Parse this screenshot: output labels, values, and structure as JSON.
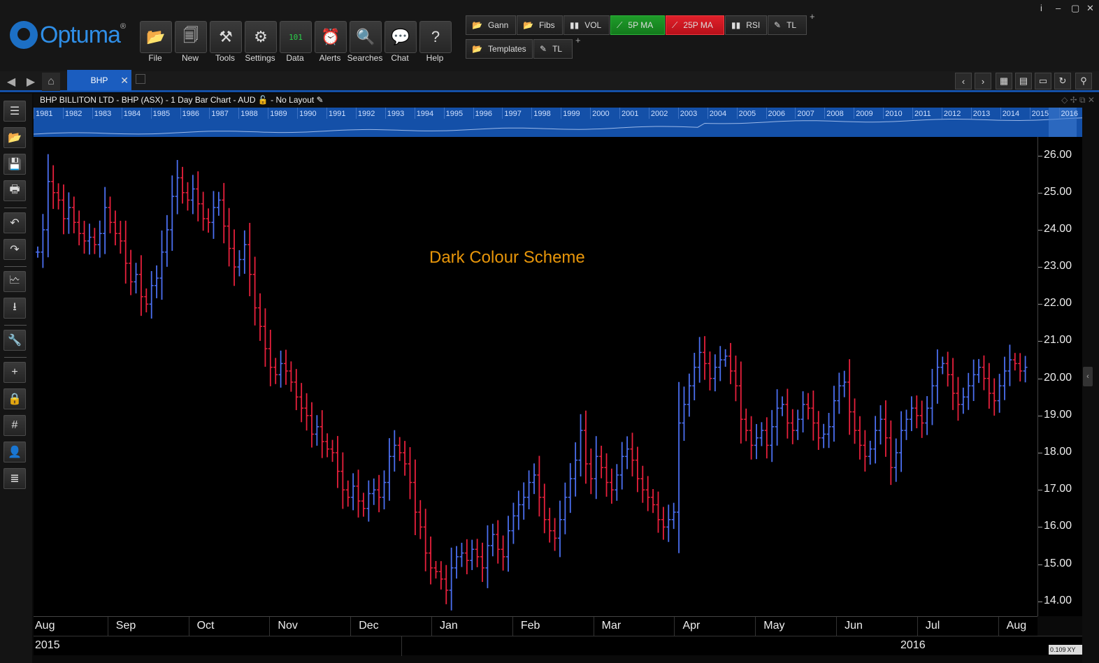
{
  "app": {
    "logo_text": "Optuma",
    "logo_mark": "®"
  },
  "window_controls": [
    "i",
    "–",
    "▢",
    "✕"
  ],
  "toolbar": [
    {
      "label": "File",
      "icon": "folder-icon",
      "glyph": "📂"
    },
    {
      "label": "New",
      "icon": "new-chart-icon",
      "glyph": "🗐"
    },
    {
      "label": "Tools",
      "icon": "tools-icon",
      "glyph": "⚒"
    },
    {
      "label": "Settings",
      "icon": "gears-icon",
      "glyph": "⚙"
    },
    {
      "label": "Data",
      "icon": "binary-data-icon",
      "glyph": "101"
    },
    {
      "label": "Alerts",
      "icon": "alarm-clock-icon",
      "glyph": "⏰"
    },
    {
      "label": "Searches",
      "icon": "magnifier-icon",
      "glyph": "🔍"
    },
    {
      "label": "Chat",
      "icon": "chat-bubbles-icon",
      "glyph": "💬"
    },
    {
      "label": "Help",
      "icon": "question-icon",
      "glyph": "?"
    }
  ],
  "quick_row1": [
    {
      "label": "Gann",
      "icon": "folder-icon",
      "glyph": "📂",
      "style": ""
    },
    {
      "label": "Fibs",
      "icon": "folder-icon",
      "glyph": "📂",
      "style": ""
    },
    {
      "label": "VOL",
      "icon": "bars-icon",
      "glyph": "▮▮",
      "style": ""
    },
    {
      "label": "5P MA",
      "icon": "line-icon",
      "glyph": "⟋",
      "style": "green"
    },
    {
      "label": "25P MA",
      "icon": "line-icon",
      "glyph": "⟋",
      "style": "red"
    },
    {
      "label": "RSI",
      "icon": "bars-icon",
      "glyph": "▮▮",
      "style": ""
    },
    {
      "label": "TL",
      "icon": "pencil-icon",
      "glyph": "✎",
      "style": ""
    }
  ],
  "quick_row2": [
    {
      "label": "Templates",
      "icon": "folder-icon",
      "glyph": "📂",
      "style": ""
    },
    {
      "label": "TL",
      "icon": "pencil-icon",
      "glyph": "✎",
      "style": ""
    }
  ],
  "tab": {
    "label": "BHP",
    "close": "✕"
  },
  "chart": {
    "header": "BHP BILLITON LTD - BHP (ASX) - 1 Day Bar Chart - AUD",
    "layout": "- No Layout",
    "annotation": "Dark Colour Scheme",
    "ratio_label": "0.109",
    "ratio_suffix": "XY"
  },
  "overview_years": [
    "1981",
    "1982",
    "1983",
    "1984",
    "1985",
    "1986",
    "1987",
    "1988",
    "1989",
    "1990",
    "1991",
    "1992",
    "1993",
    "1994",
    "1995",
    "1996",
    "1997",
    "1998",
    "1999",
    "2000",
    "2001",
    "2002",
    "2003",
    "2004",
    "2005",
    "2006",
    "2007",
    "2008",
    "2009",
    "2010",
    "2011",
    "2012",
    "2013",
    "2014",
    "2015",
    "2016"
  ],
  "chart_data": {
    "type": "bar",
    "title": "BHP BILLITON LTD - BHP (ASX) - 1 Day Bar Chart - AUD",
    "ylim": [
      13.6,
      26.5
    ],
    "y_ticks": [
      "26.00",
      "25.00",
      "24.00",
      "23.00",
      "22.00",
      "21.00",
      "20.00",
      "19.00",
      "18.00",
      "17.00",
      "16.00",
      "15.00",
      "14.00"
    ],
    "x_months": [
      "Aug",
      "Sep",
      "Oct",
      "Nov",
      "Dec",
      "Jan",
      "Feb",
      "Mar",
      "Apr",
      "May",
      "Jun",
      "Jul",
      "Aug"
    ],
    "x_years": [
      "2015",
      "2016"
    ],
    "colors": {
      "up": "#4b6ff0",
      "down": "#e8203c",
      "background": "#000000"
    },
    "closes": [
      23.4,
      24.0,
      25.3,
      25.0,
      24.8,
      24.3,
      24.6,
      24.2,
      23.9,
      23.7,
      23.8,
      23.6,
      23.9,
      24.6,
      24.2,
      23.9,
      23.7,
      23.1,
      22.6,
      22.8,
      22.2,
      22.0,
      22.5,
      22.7,
      23.4,
      24.0,
      24.9,
      25.4,
      25.0,
      24.8,
      25.1,
      24.7,
      24.3,
      24.2,
      24.6,
      24.8,
      24.1,
      23.5,
      23.0,
      23.2,
      23.6,
      22.8,
      21.9,
      21.4,
      20.8,
      20.3,
      20.1,
      20.4,
      20.2,
      19.9,
      19.5,
      19.2,
      19.0,
      18.5,
      18.7,
      18.3,
      18.1,
      18.0,
      17.5,
      17.0,
      16.8,
      17.1,
      16.7,
      16.5,
      16.9,
      17.0,
      16.8,
      17.2,
      17.9,
      18.2,
      18.0,
      17.7,
      17.2,
      16.4,
      16.0,
      15.3,
      14.9,
      14.8,
      14.6,
      14.3,
      14.9,
      15.2,
      15.3,
      15.1,
      15.4,
      15.2,
      14.9,
      15.5,
      15.8,
      15.4,
      15.2,
      15.9,
      16.3,
      16.6,
      16.8,
      17.2,
      17.4,
      16.8,
      16.2,
      15.9,
      15.7,
      16.2,
      16.8,
      17.3,
      17.8,
      18.6,
      17.7,
      17.3,
      17.9,
      17.6,
      17.2,
      17.0,
      17.4,
      17.9,
      18.1,
      17.8,
      17.3,
      17.0,
      16.8,
      16.6,
      16.2,
      16.0,
      16.2,
      16.4,
      18.8,
      19.3,
      19.8,
      20.3,
      20.7,
      20.4,
      20.0,
      20.3,
      20.5,
      20.6,
      20.2,
      19.8,
      18.9,
      18.6,
      18.2,
      18.4,
      18.6,
      18.2,
      18.7,
      19.2,
      19.3,
      18.8,
      18.6,
      18.9,
      19.3,
      19.2,
      18.8,
      18.4,
      18.5,
      18.7,
      19.4,
      19.8,
      19.9,
      19.1,
      18.6,
      18.2,
      17.9,
      18.1,
      18.6,
      18.9,
      18.4,
      17.6,
      18.0,
      18.6,
      18.9,
      19.2,
      19.0,
      18.8,
      19.2,
      19.8,
      20.3,
      20.4,
      20.1,
      19.6,
      19.3,
      19.5,
      19.8,
      20.1,
      20.3,
      20.0,
      19.6,
      19.4,
      19.8,
      20.2,
      20.5,
      20.4,
      20.2,
      20.3
    ]
  }
}
